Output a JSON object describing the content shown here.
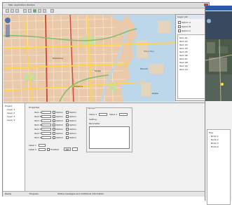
{
  "main_window": {
    "title": "Main Application Window",
    "menu": [
      "File",
      "Edit",
      "View",
      "Tools",
      "Help"
    ]
  },
  "map": {
    "places": [
      "Tokyo Bay",
      "Shiodome",
      "Tsukiji",
      "Harumi",
      "Shibaura",
      "Daiba"
    ]
  },
  "left_tree": {
    "root": "Project",
    "items": [
      "Layer 1",
      "Layer 2",
      "Layer 3",
      "Layer 4"
    ]
  },
  "form": {
    "section_title": "Properties",
    "rows": [
      "Item A",
      "Item B",
      "Item C",
      "Item D",
      "Item E",
      "Item F",
      "Item G"
    ],
    "options": [
      "Option",
      "Option",
      "Option",
      "Option",
      "Option",
      "Option",
      "Option"
    ],
    "bottom_labels": [
      "Label 1",
      "Label 2"
    ],
    "bottom_option": "Enabled",
    "ok_button": "OK"
  },
  "group_box": {
    "title": "Group",
    "row1_a": "Value 1",
    "row1_b": "Value 2",
    "row2": "Setting",
    "row3": "Parameter"
  },
  "status_bar": {
    "left": "Ready",
    "mid": "Progress",
    "right": "Status messages and additional information"
  },
  "side_panel": {
    "title": "Layer List",
    "options": [
      "Option A",
      "Option B",
      "Option C"
    ],
    "list": [
      "Item 01",
      "Item 02",
      "Item 03",
      "Item 04",
      "Item 05",
      "Item 06",
      "Item 07",
      "Item 08",
      "Item 09",
      "Item 10"
    ]
  },
  "second_window": {
    "tree_root": "Tree",
    "tree_items": [
      "Node 1",
      "Node 2",
      "Node 3",
      "Node 4"
    ]
  },
  "colors": {
    "map_base": "#e9c9a9",
    "water": "#bcd7ea",
    "road_major": "#ffd54a",
    "road_red": "#d24a3a",
    "panel_bg": "#f0f0f0",
    "accent": "#2d5aa8"
  }
}
